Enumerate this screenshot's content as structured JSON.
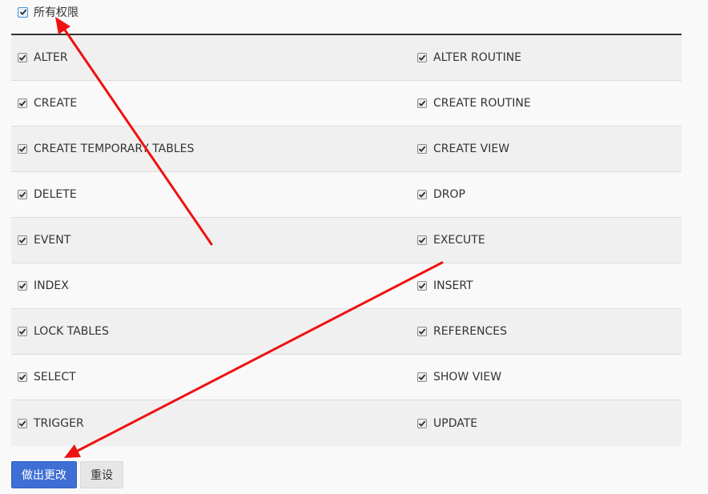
{
  "all_privileges": {
    "label": "所有权限",
    "checked": true
  },
  "privileges": [
    {
      "left": "ALTER",
      "right": "ALTER ROUTINE"
    },
    {
      "left": "CREATE",
      "right": "CREATE ROUTINE"
    },
    {
      "left": "CREATE TEMPORARY TABLES",
      "right": "CREATE VIEW"
    },
    {
      "left": "DELETE",
      "right": "DROP"
    },
    {
      "left": "EVENT",
      "right": "EXECUTE"
    },
    {
      "left": "INDEX",
      "right": "INSERT"
    },
    {
      "left": "LOCK TABLES",
      "right": "REFERENCES"
    },
    {
      "left": "SELECT",
      "right": "SHOW VIEW"
    },
    {
      "left": "TRIGGER",
      "right": "UPDATE"
    }
  ],
  "buttons": {
    "save_label": "做出更改",
    "reset_label": "重设"
  },
  "colors": {
    "primary": "#3f6fd4",
    "annotation_arrow": "#ee1111"
  }
}
